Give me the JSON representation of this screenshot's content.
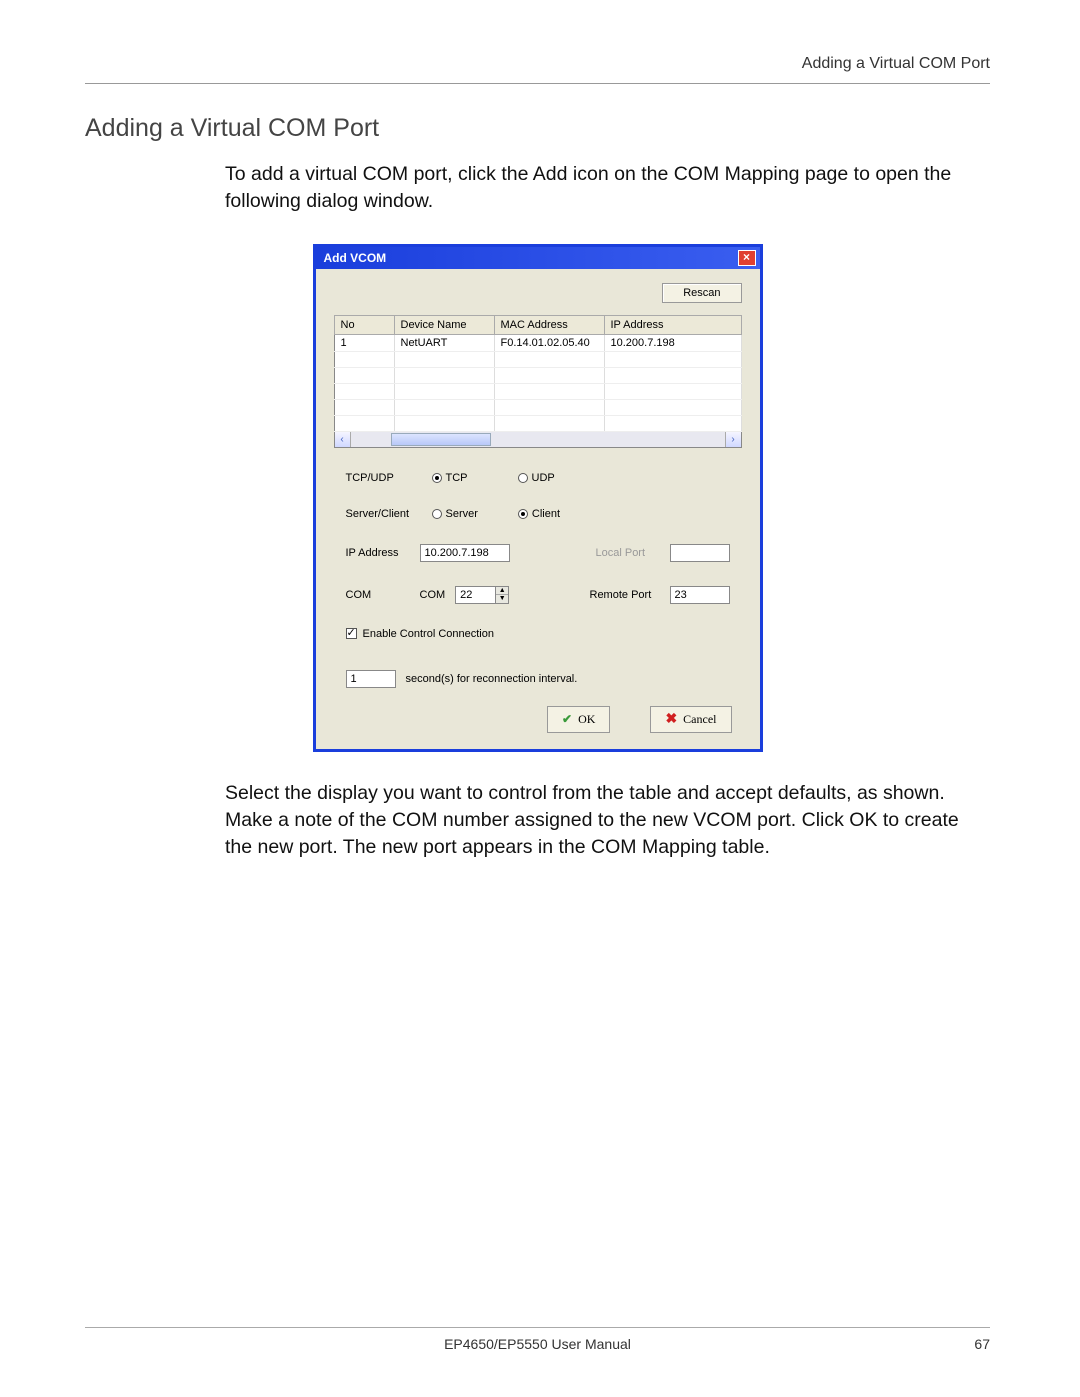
{
  "header": {
    "right": "Adding a Virtual COM Port"
  },
  "section": {
    "title": "Adding a Virtual COM Port"
  },
  "intro": "To add a virtual COM port, click the Add icon on the COM Mapping page to open the following dialog window.",
  "outro": "Select the display you want to control from the table and accept defaults, as shown. Make a note of the COM number assigned to the new VCOM port. Click OK to create the new port. The new port appears in the COM Mapping table.",
  "dialog": {
    "title": "Add VCOM",
    "rescan": "Rescan",
    "table": {
      "headers": [
        "No",
        "Device Name",
        "MAC Address",
        "IP Address"
      ],
      "rows": [
        {
          "no": "1",
          "device": "NetUART",
          "mac": "F0.14.01.02.05.40",
          "ip": "10.200.7.198"
        }
      ]
    },
    "fields": {
      "tcpudp_label": "TCP/UDP",
      "tcp": "TCP",
      "udp": "UDP",
      "sc_label": "Server/Client",
      "server": "Server",
      "client": "Client",
      "ip_label": "IP Address",
      "ip_value": "10.200.7.198",
      "localport_label": "Local Port",
      "localport_value": "",
      "com_label": "COM",
      "com_prefix": "COM",
      "com_value": "22",
      "remoteport_label": "Remote Port",
      "remoteport_value": "23",
      "enable_cc": "Enable Control Connection",
      "reconnect_value": "1",
      "reconnect_suffix": "second(s) for reconnection interval."
    },
    "buttons": {
      "ok": "OK",
      "cancel": "Cancel"
    }
  },
  "footer": {
    "center": "EP4650/EP5550 User Manual",
    "page": "67"
  }
}
